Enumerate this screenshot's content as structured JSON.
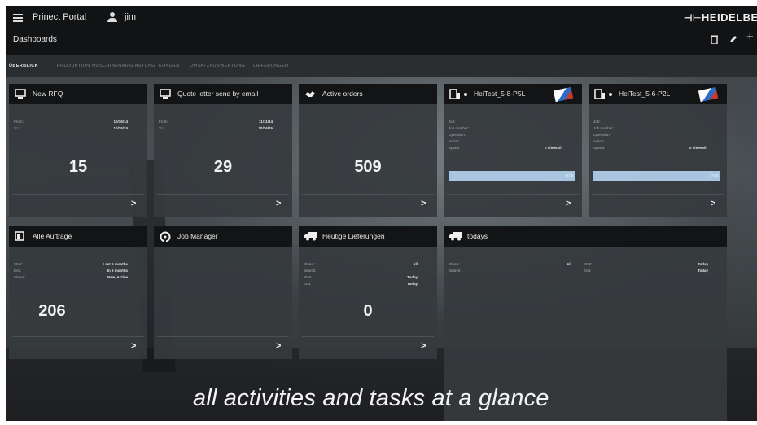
{
  "app": {
    "title": "Prinect Portal",
    "user": "jim",
    "brand": "HEIDELBERG",
    "page_title": "Dashboards"
  },
  "tabs": [
    {
      "label": "ÜBERBLICK",
      "active": true
    },
    {
      "label": "PRODUKTION",
      "active": false
    },
    {
      "label": "MASCHINENAUSLASTUNG",
      "active": false
    },
    {
      "label": "KUNDEN",
      "active": false
    },
    {
      "label": "UMSATZAUSWERTUNG",
      "active": false
    },
    {
      "label": "LIEFERUNGEN",
      "active": false
    }
  ],
  "tiles": {
    "new_rfq": {
      "title": "New RFQ",
      "icon": "card-icon",
      "fields": [
        {
          "k": "From:",
          "v": "10/16/14"
        },
        {
          "k": "To:",
          "v": "10/15/15"
        }
      ],
      "value": "15"
    },
    "quote": {
      "title": "Quote letter send by email",
      "icon": "card-icon",
      "fields": [
        {
          "k": "From:",
          "v": "11/11/14"
        },
        {
          "k": "To:",
          "v": "10/26/15"
        }
      ],
      "value": "29"
    },
    "active_orders": {
      "title": "Active orders",
      "icon": "handshake-icon",
      "value": "509"
    },
    "heitest_1": {
      "title": "HeiTest_5-8-P5L",
      "icon": "press-icon",
      "fields": [
        {
          "k": "Job:",
          "v": ""
        },
        {
          "k": "Job number:",
          "v": ""
        },
        {
          "k": "Operation:",
          "v": ""
        },
        {
          "k": "Action:",
          "v": ""
        },
        {
          "k": "Speed:",
          "v": "0 sheets/h"
        }
      ],
      "progress_label": "0 / 0"
    },
    "heitest_2": {
      "title": "HeiTest_5-6-P2L",
      "icon": "press-icon",
      "fields": [
        {
          "k": "Job:",
          "v": ""
        },
        {
          "k": "Job number:",
          "v": ""
        },
        {
          "k": "Operation:",
          "v": ""
        },
        {
          "k": "Action:",
          "v": ""
        },
        {
          "k": "Speed:",
          "v": "0 sheets/h"
        }
      ],
      "progress_label": "0 / 0"
    },
    "alle": {
      "title": "Alle Aufträge",
      "icon": "folder-icon",
      "fields": [
        {
          "k": "Start:",
          "v": "Last 6 months"
        },
        {
          "k": "End:",
          "v": "In 6 months"
        },
        {
          "k": "Status:",
          "v": "New, Active"
        }
      ],
      "value": "206"
    },
    "job_manager": {
      "title": "Job Manager",
      "icon": "gauge-icon"
    },
    "heutige": {
      "title": "Heutige Lieferungen",
      "icon": "truck-icon",
      "fields": [
        {
          "k": "Status:",
          "v": "All"
        },
        {
          "k": "Search:",
          "v": ""
        },
        {
          "k": "Start:",
          "v": "Today"
        },
        {
          "k": "End:",
          "v": "Today"
        }
      ],
      "value": "0"
    },
    "todays": {
      "title": "todays",
      "icon": "truck-icon",
      "fields_left": [
        {
          "k": "Status:",
          "v": "All"
        },
        {
          "k": "Search:",
          "v": ""
        }
      ],
      "fields_right": [
        {
          "k": "Start:",
          "v": "Today"
        },
        {
          "k": "End:",
          "v": "Today"
        }
      ]
    }
  },
  "tagline": "all activities and tasks at a glance"
}
